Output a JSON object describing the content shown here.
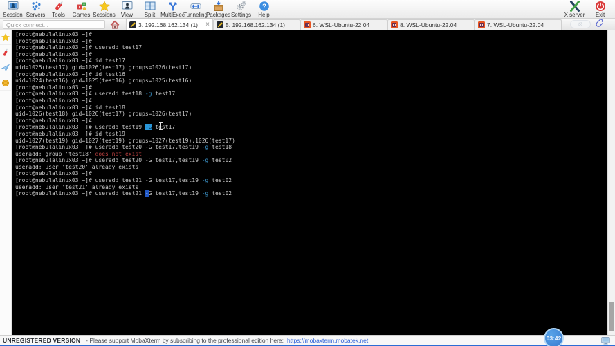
{
  "toolbar": {
    "items": [
      {
        "label": "Session",
        "icon": "session"
      },
      {
        "label": "Servers",
        "icon": "servers"
      },
      {
        "label": "Tools",
        "icon": "tools"
      },
      {
        "label": "Games",
        "icon": "games"
      },
      {
        "label": "Sessions",
        "icon": "sessions-star"
      },
      {
        "label": "View",
        "icon": "view"
      },
      {
        "label": "Split",
        "icon": "split"
      },
      {
        "label": "MultiExec",
        "icon": "multiexec"
      },
      {
        "label": "Tunneling",
        "icon": "tunneling"
      },
      {
        "label": "Packages",
        "icon": "packages"
      },
      {
        "label": "Settings",
        "icon": "settings"
      },
      {
        "label": "Help",
        "icon": "help"
      }
    ],
    "right_items": [
      {
        "label": "X server",
        "icon": "xserver"
      },
      {
        "label": "Exit",
        "icon": "exit"
      }
    ]
  },
  "quick_connect": {
    "placeholder": "Quick connect..."
  },
  "tabs": [
    {
      "label": "3. 192.168.162.134 (1)",
      "icon": "ssh",
      "active": true,
      "close": "×"
    },
    {
      "label": "5. 192.168.162.134 (1)",
      "icon": "ssh",
      "active": false
    },
    {
      "label": "6. WSL-Ubuntu-22.04",
      "icon": "wsl",
      "active": false
    },
    {
      "label": "8. WSL-Ubuntu-22.04",
      "icon": "wsl",
      "active": false
    },
    {
      "label": "7. WSL-Ubuntu-22.04",
      "icon": "wsl",
      "active": false
    }
  ],
  "sidebar": {
    "icons": [
      "star",
      "knife",
      "paper-plane",
      "coin"
    ]
  },
  "terminal": {
    "lines": [
      [
        [
          "[root@nebulalinux03 ~]#",
          "d"
        ]
      ],
      [
        [
          "[root@nebulalinux03 ~]#",
          "d"
        ]
      ],
      [
        [
          "[root@nebulalinux03 ~]# useradd test17",
          "d"
        ]
      ],
      [
        [
          "[root@nebulalinux03 ~]#",
          "d"
        ]
      ],
      [
        [
          "[root@nebulalinux03 ~]# id test17",
          "d"
        ]
      ],
      [
        [
          "uid=1025(test17) gid=1026(test17) groups=1026(test17)",
          "d"
        ]
      ],
      [
        [
          "[root@nebulalinux03 ~]# id test16",
          "d"
        ]
      ],
      [
        [
          "uid=1024(test16) gid=1025(test16) groups=1025(test16)",
          "d"
        ]
      ],
      [
        [
          "[root@nebulalinux03 ~]#",
          "d"
        ]
      ],
      [
        [
          "[root@nebulalinux03 ~]# useradd test18 ",
          "d"
        ],
        [
          "-g",
          "o"
        ],
        [
          " test17",
          "d"
        ]
      ],
      [
        [
          "[root@nebulalinux03 ~]#",
          "d"
        ]
      ],
      [
        [
          "[root@nebulalinux03 ~]# id test18",
          "d"
        ]
      ],
      [
        [
          "uid=1026(test18) gid=1026(test17) groups=1026(test17)",
          "d"
        ]
      ],
      [
        [
          "[root@nebulalinux03 ~]#",
          "d"
        ]
      ],
      [
        [
          "[root@nebulalinux03 ~]# useradd test19 ",
          "d"
        ],
        [
          "-G",
          "sel"
        ],
        [
          " test17",
          "d"
        ]
      ],
      [
        [
          "[root@nebulalinux03 ~]# id test19",
          "d"
        ]
      ],
      [
        [
          "uid=1027(test19) gid=1027(test19) groups=1027(test19),1026(test17)",
          "d"
        ]
      ],
      [
        [
          "[root@nebulalinux03 ~]# useradd test20 -G test17,test19 ",
          "d"
        ],
        [
          "-g",
          "o"
        ],
        [
          " test18",
          "d"
        ]
      ],
      [
        [
          "useradd: group 'test18' ",
          "d"
        ],
        [
          "does not exist",
          "e"
        ]
      ],
      [
        [
          "[root@nebulalinux03 ~]# useradd test20 -G test17,test19 ",
          "d"
        ],
        [
          "-g",
          "o"
        ],
        [
          " test02",
          "d"
        ]
      ],
      [
        [
          "useradd: user 'test20' already exists",
          "d"
        ]
      ],
      [
        [
          "[root@nebulalinux03 ~]#",
          "d"
        ]
      ],
      [
        [
          "[root@nebulalinux03 ~]# useradd test21 -G test17,test19 ",
          "d"
        ],
        [
          "-g",
          "o"
        ],
        [
          " test02",
          "d"
        ]
      ],
      [
        [
          "useradd: user 'test21' already exists",
          "d"
        ]
      ],
      [
        [
          "[root@nebulalinux03 ~]# useradd test21 ",
          "d"
        ],
        [
          "-",
          "cur"
        ],
        [
          "G test17,test19 ",
          "d"
        ],
        [
          "-g",
          "o"
        ],
        [
          " test02",
          "d"
        ]
      ]
    ]
  },
  "statusbar": {
    "version_label": "UNREGISTERED VERSION",
    "message": "-  Please support MobaXterm by subscribing to the professional edition here:",
    "link": "https://mobaxterm.mobatek.net"
  },
  "clock": {
    "time": "03:42"
  },
  "colors": {
    "terminal_bg": "#000000",
    "terminal_fg": "#c8c8c8",
    "option_fg": "#3f9fd9",
    "error_fg": "#bc4040",
    "selection_bg": "#2996d8",
    "cursor_bg": "#2058c8",
    "statusbar_accent": "#2b6cd4",
    "link": "#2b5fd9"
  }
}
